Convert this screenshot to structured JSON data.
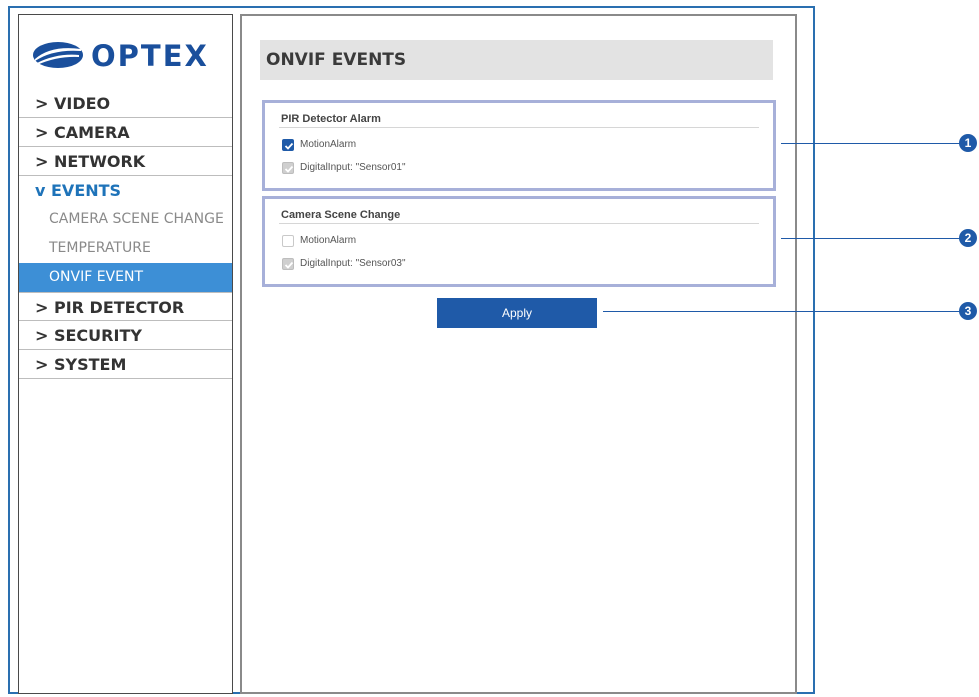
{
  "brand": {
    "logo_text": "OPTEX"
  },
  "sidebar": {
    "items": [
      {
        "label": "> VIDEO"
      },
      {
        "label": "> CAMERA"
      },
      {
        "label": "> NETWORK"
      },
      {
        "label": "v EVENTS"
      },
      {
        "label": "> PIR DETECTOR"
      },
      {
        "label": "> SECURITY"
      },
      {
        "label": "> SYSTEM"
      }
    ],
    "events_sub": [
      {
        "label": "CAMERA SCENE CHANGE"
      },
      {
        "label": "TEMPERATURE"
      },
      {
        "label": "ONVIF EVENT"
      }
    ]
  },
  "page": {
    "title": "ONVIF EVENTS",
    "groups": [
      {
        "title": "PIR Detector Alarm",
        "options": [
          {
            "label": "MotionAlarm",
            "state": "checked"
          },
          {
            "label": "DigitalInput: \"Sensor01\"",
            "state": "checked-disabled"
          }
        ]
      },
      {
        "title": "Camera Scene Change",
        "options": [
          {
            "label": "MotionAlarm",
            "state": "unchecked"
          },
          {
            "label": "DigitalInput: \"Sensor03\"",
            "state": "checked-disabled"
          }
        ]
      }
    ],
    "apply_label": "Apply"
  },
  "callouts": [
    "1",
    "2",
    "3"
  ],
  "colors": {
    "accent": "#1f5aa8",
    "active_menu": "#3d8fd6",
    "events_open": "#1e73b9"
  }
}
